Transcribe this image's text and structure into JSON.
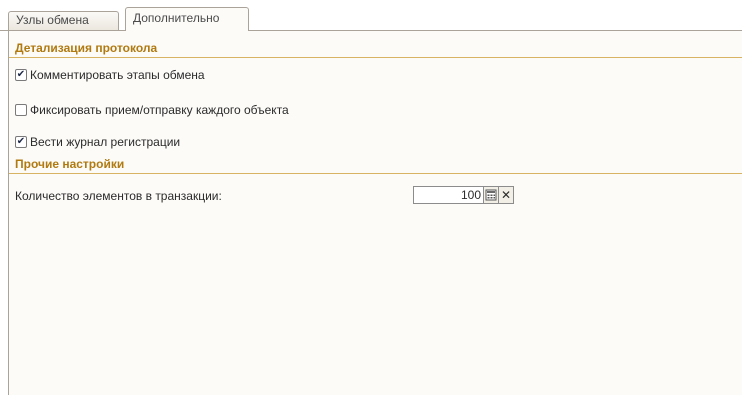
{
  "tabs": [
    {
      "label": "Узлы обмена",
      "active": false
    },
    {
      "label": "Дополнительно",
      "active": true
    }
  ],
  "sections": {
    "protocol": {
      "title": "Детализация протокола",
      "options": [
        {
          "label": "Комментировать этапы обмена",
          "checked": true
        },
        {
          "label": "Фиксировать прием/отправку каждого объекта",
          "checked": false
        },
        {
          "label": "Вести журнал регистрации",
          "checked": true
        }
      ]
    },
    "other": {
      "title": "Прочие настройки",
      "transaction_count_label": "Количество элементов в транзакции:",
      "transaction_count_value": "100"
    }
  },
  "icons": {
    "checked_mark": "✔",
    "clear": "✕",
    "calculator": "calculator-icon"
  },
  "colors": {
    "section_header": "#b07a10",
    "section_line": "#d8b363",
    "panel_bg": "#fcfbf8",
    "tab_border": "#a9a39a"
  }
}
